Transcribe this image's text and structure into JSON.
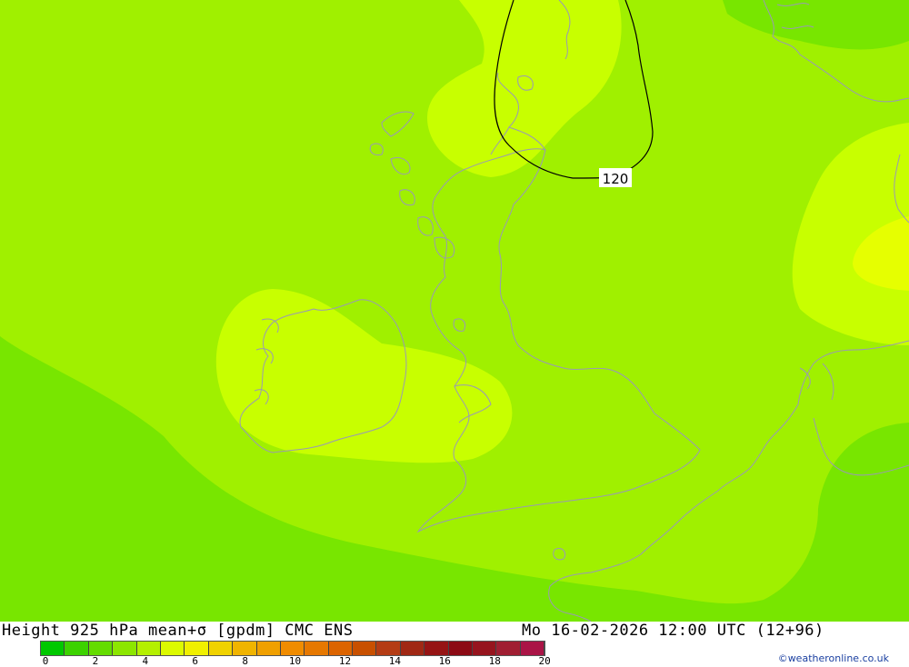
{
  "header": {
    "title": "Height 925 hPa mean+σ [gpdm] CMC ENS",
    "datetime": "Mo 16-02-2026 12:00 UTC (12+96)"
  },
  "credit": "©weatheronline.co.uk",
  "map": {
    "contour_value_label": "120",
    "field_colors": {
      "band_4_6": "#78e600",
      "band_6_8": "#a0f000",
      "band_8_10": "#c8ff00",
      "band_10_12": "#e6ff00",
      "coastline": "#9a9ab4",
      "contour_line": "#000000"
    }
  },
  "colorbar": {
    "colors": [
      "#00c800",
      "#3cd200",
      "#64dc00",
      "#8ce600",
      "#b4f000",
      "#dcfa00",
      "#f0f000",
      "#f0d200",
      "#f0b400",
      "#f0a000",
      "#f08c00",
      "#e67800",
      "#dc6400",
      "#c85000",
      "#b43c14",
      "#a02814",
      "#961414",
      "#8c0a14",
      "#96141e",
      "#a01e32",
      "#aa1446"
    ],
    "labels": [
      "0",
      "2",
      "4",
      "6",
      "8",
      "10",
      "12",
      "14",
      "16",
      "18",
      "20"
    ]
  }
}
